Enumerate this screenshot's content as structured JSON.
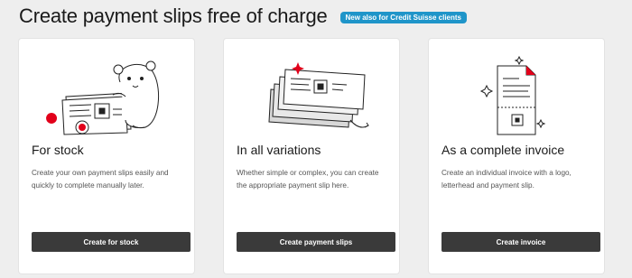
{
  "header": {
    "title": "Create payment slips free of charge",
    "badge": "New also for Credit Suisse clients"
  },
  "cards": [
    {
      "illustration": "hamster-with-payment-slip",
      "title": "For stock",
      "description": "Create your own payment slips easily and quickly to complete manually later.",
      "button_label": "Create for stock"
    },
    {
      "illustration": "stacked-payment-slips",
      "title": "In all variations",
      "description": "Whether simple or complex, you can create the appropriate payment slip here.",
      "button_label": "Create payment slips"
    },
    {
      "illustration": "invoice-document",
      "title": "As a complete invoice",
      "description": "Create an individual invoice with a logo, letterhead and payment slip.",
      "button_label": "Create invoice"
    }
  ],
  "colors": {
    "page_background": "#eeeeee",
    "badge": "#1f95c9",
    "button": "#3a3a3a",
    "accent_red": "#e2001a"
  }
}
